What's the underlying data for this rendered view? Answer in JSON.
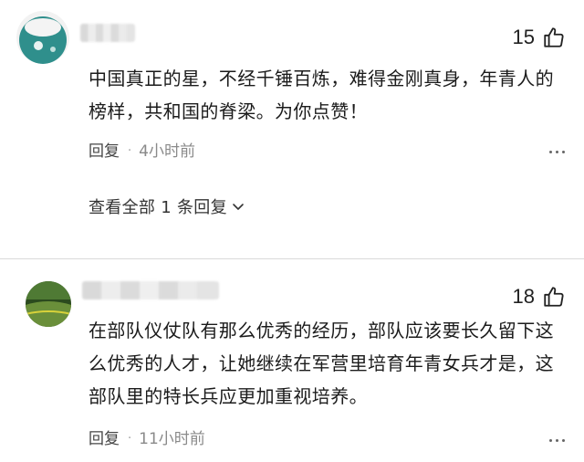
{
  "comments": [
    {
      "likes": "15",
      "text": "中国真正的星，不经千锤百炼，难得金刚真身，年青人的榜样，共和国的脊梁。为你点赞！",
      "reply_label": "回复",
      "separator": "·",
      "time": "4小时前",
      "view_replies": "查看全部 1 条回复"
    },
    {
      "likes": "18",
      "text": "在部队仪仗队有那么优秀的经历，部队应该要长久留下这么优秀的人才，让她继续在军营里培育年青女兵才是，这部队里的特长兵应更加重视培养。",
      "reply_label": "回复",
      "separator": "·",
      "time": "11小时前"
    }
  ],
  "icons": {
    "like": "thumbs-up-icon",
    "more": "more-dots-icon",
    "expand": "chevron-down-icon"
  },
  "colors": {
    "text": "#1b1b1b",
    "meta": "#8a8a8a",
    "avatar1": "#2f8f8c",
    "avatar2": "#3d6b2a"
  }
}
